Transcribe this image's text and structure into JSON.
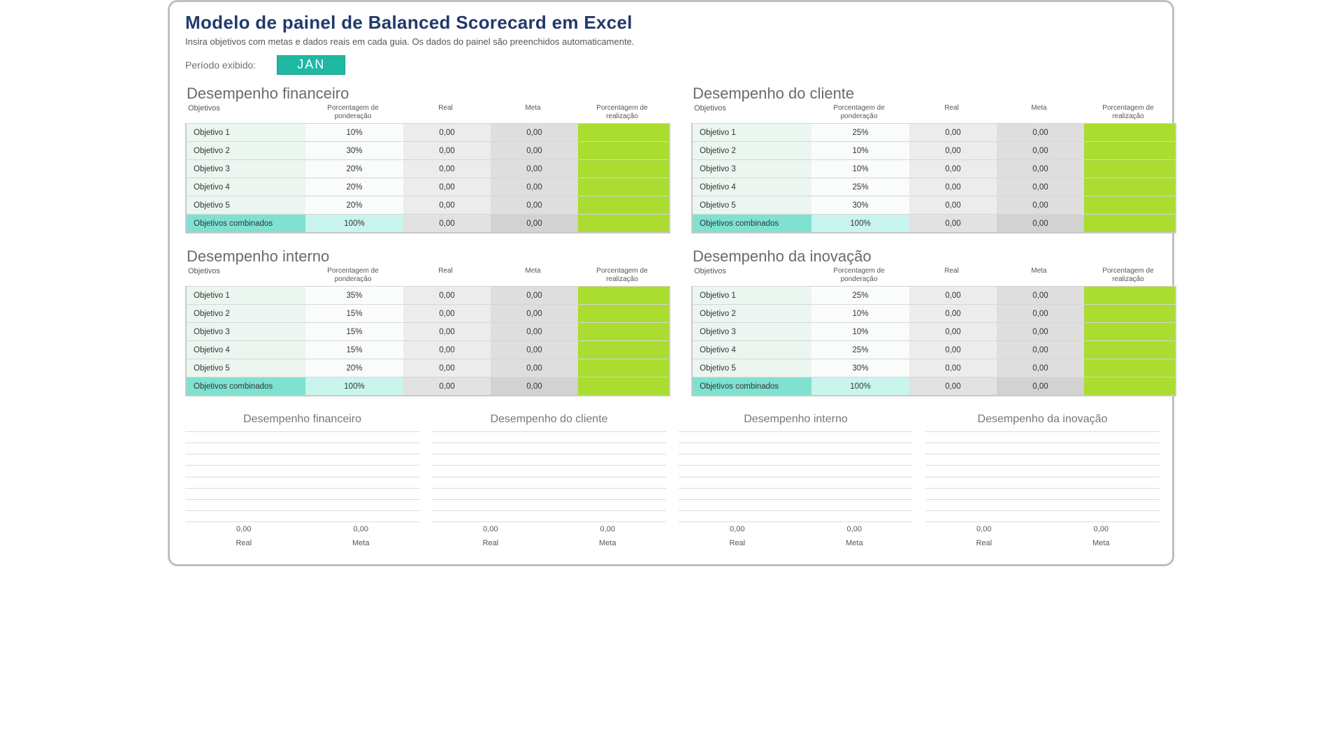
{
  "title": "Modelo de painel de Balanced Scorecard em Excel",
  "subtitle": "Insira objetivos com metas e dados reais em cada guia. Os dados do painel são preenchidos automaticamente.",
  "period_label": "Período exibido:",
  "period_value": "JAN",
  "columns": {
    "objetivos": "Objetivos",
    "ponderacao": "Porcentagem de ponderação",
    "real": "Real",
    "meta": "Meta",
    "realizacao": "Porcentagem de realização"
  },
  "sections": [
    {
      "key": "financeiro",
      "heading": "Desempenho financeiro",
      "rows": [
        {
          "obj": "Objetivo 1",
          "pct": "10%",
          "real": "0,00",
          "meta": "0,00"
        },
        {
          "obj": "Objetivo 2",
          "pct": "30%",
          "real": "0,00",
          "meta": "0,00"
        },
        {
          "obj": "Objetivo 3",
          "pct": "20%",
          "real": "0,00",
          "meta": "0,00"
        },
        {
          "obj": "Objetivo 4",
          "pct": "20%",
          "real": "0,00",
          "meta": "0,00"
        },
        {
          "obj": "Objetivo 5",
          "pct": "20%",
          "real": "0,00",
          "meta": "0,00"
        }
      ],
      "total": {
        "obj": "Objetivos combinados",
        "pct": "100%",
        "real": "0,00",
        "meta": "0,00"
      }
    },
    {
      "key": "cliente",
      "heading": "Desempenho do cliente",
      "rows": [
        {
          "obj": "Objetivo 1",
          "pct": "25%",
          "real": "0,00",
          "meta": "0,00"
        },
        {
          "obj": "Objetivo 2",
          "pct": "10%",
          "real": "0,00",
          "meta": "0,00"
        },
        {
          "obj": "Objetivo 3",
          "pct": "10%",
          "real": "0,00",
          "meta": "0,00"
        },
        {
          "obj": "Objetivo 4",
          "pct": "25%",
          "real": "0,00",
          "meta": "0,00"
        },
        {
          "obj": "Objetivo 5",
          "pct": "30%",
          "real": "0,00",
          "meta": "0,00"
        }
      ],
      "total": {
        "obj": "Objetivos combinados",
        "pct": "100%",
        "real": "0,00",
        "meta": "0,00"
      }
    },
    {
      "key": "interno",
      "heading": "Desempenho interno",
      "rows": [
        {
          "obj": "Objetivo 1",
          "pct": "35%",
          "real": "0,00",
          "meta": "0,00"
        },
        {
          "obj": "Objetivo 2",
          "pct": "15%",
          "real": "0,00",
          "meta": "0,00"
        },
        {
          "obj": "Objetivo 3",
          "pct": "15%",
          "real": "0,00",
          "meta": "0,00"
        },
        {
          "obj": "Objetivo 4",
          "pct": "15%",
          "real": "0,00",
          "meta": "0,00"
        },
        {
          "obj": "Objetivo 5",
          "pct": "20%",
          "real": "0,00",
          "meta": "0,00"
        }
      ],
      "total": {
        "obj": "Objetivos combinados",
        "pct": "100%",
        "real": "0,00",
        "meta": "0,00"
      }
    },
    {
      "key": "inovacao",
      "heading": "Desempenho da inovação",
      "rows": [
        {
          "obj": "Objetivo 1",
          "pct": "25%",
          "real": "0,00",
          "meta": "0,00"
        },
        {
          "obj": "Objetivo 2",
          "pct": "10%",
          "real": "0,00",
          "meta": "0,00"
        },
        {
          "obj": "Objetivo 3",
          "pct": "10%",
          "real": "0,00",
          "meta": "0,00"
        },
        {
          "obj": "Objetivo 4",
          "pct": "25%",
          "real": "0,00",
          "meta": "0,00"
        },
        {
          "obj": "Objetivo 5",
          "pct": "30%",
          "real": "0,00",
          "meta": "0,00"
        }
      ],
      "total": {
        "obj": "Objetivos combinados",
        "pct": "100%",
        "real": "0,00",
        "meta": "0,00"
      }
    }
  ],
  "chart_data": [
    {
      "type": "bar",
      "title": "Desempenho financeiro",
      "categories": [
        "Real",
        "Meta"
      ],
      "values": [
        0.0,
        0.0
      ],
      "value_labels": [
        "0,00",
        "0,00"
      ]
    },
    {
      "type": "bar",
      "title": "Desempenho do cliente",
      "categories": [
        "Real",
        "Meta"
      ],
      "values": [
        0.0,
        0.0
      ],
      "value_labels": [
        "0,00",
        "0,00"
      ]
    },
    {
      "type": "bar",
      "title": "Desempenho interno",
      "categories": [
        "Real",
        "Meta"
      ],
      "values": [
        0.0,
        0.0
      ],
      "value_labels": [
        "0,00",
        "0,00"
      ]
    },
    {
      "type": "bar",
      "title": "Desempenho da inovação",
      "categories": [
        "Real",
        "Meta"
      ],
      "values": [
        0.0,
        0.0
      ],
      "value_labels": [
        "0,00",
        "0,00"
      ]
    }
  ]
}
